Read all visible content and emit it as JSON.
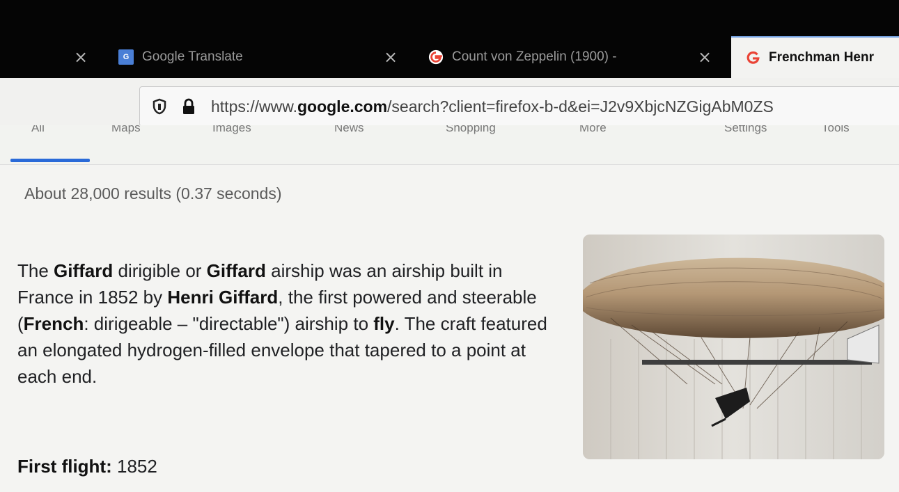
{
  "browser": {
    "tabs": [
      {
        "title": "",
        "close": "×",
        "active": false
      },
      {
        "title": "Google Translate",
        "close": "×",
        "active": false
      },
      {
        "title": "Count von Zeppelin (1900) - ",
        "close": "×",
        "active": false
      },
      {
        "title": "Frenchman Henr",
        "active": true
      }
    ],
    "url_prefix": "https://www.",
    "url_domain": "google.com",
    "url_rest": "/search?client=firefox-b-d&ei=J2v9XbjcNZGigAbM0ZS"
  },
  "search_tabs": [
    "All",
    "Maps",
    "Images",
    "News",
    "Shopping",
    "More",
    "Settings",
    "Tools"
  ],
  "result_stats": "About 28,000 results (0.37 seconds)",
  "snippet": {
    "p1": "The ",
    "b1": "Giffard",
    "p2": " dirigible or ",
    "b2": "Giffard",
    "p3": " airship was an airship built in France in 1852 by ",
    "b3": "Henri Giffard",
    "p4": ", the first powered and steerable (",
    "b4": "French",
    "p5": ": dirigeable – \"directable\") airship to ",
    "b5": "fly",
    "p6": ". The craft featured an elongated hydrogen-filled envelope that tapered to a point at each end."
  },
  "fact": {
    "label": "First flight:",
    "value": " 1852"
  },
  "icons": {
    "tracking": "shield-icon",
    "secure": "lock-icon",
    "favicon_google": "google-g-icon",
    "favicon_translate": "translate-icon"
  },
  "colors": {
    "tab_active_bar": "#2a6ad8",
    "google_red": "#ea4335"
  }
}
